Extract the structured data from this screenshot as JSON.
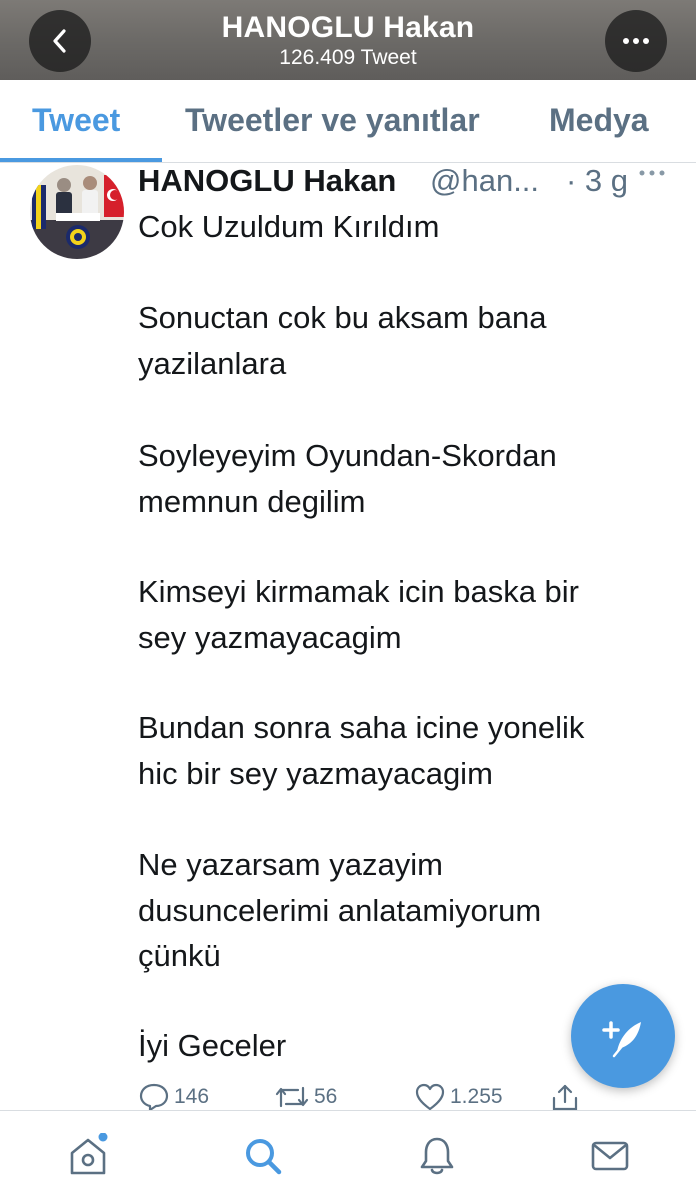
{
  "header": {
    "title": "HANOGLU Hakan",
    "subtitle": "126.409 Tweet"
  },
  "tabs": [
    {
      "label": "Tweet",
      "active": true
    },
    {
      "label": "Tweetler ve yanıtlar",
      "active": false
    },
    {
      "label": "Medya",
      "active": false
    }
  ],
  "tweet": {
    "author_name": "HANOGLU Hakan",
    "author_handle": "@han...",
    "time": "· 3 g",
    "lines": [
      "Cok Uzuldum Kırıldım",
      "Sonuctan cok bu aksam bana",
      "yazilanlara",
      "Soyleyeyim Oyundan-Skordan",
      "memnun degilim",
      "Kimseyi kirmamak icin baska bir",
      "sey yazmayacagim",
      "Bundan sonra saha icine yonelik",
      "hic bir sey yazmayacagim",
      "Ne yazarsam yazayim",
      "dusuncelerimi anlatamiyorum",
      "çünkü",
      "İyi Geceler"
    ],
    "replies": "146",
    "retweets": "56",
    "likes": "1.255"
  },
  "icons": {
    "back": "chevron-left-icon",
    "more": "ellipsis-icon",
    "compose": "compose-tweet-icon",
    "nav": [
      "home-icon",
      "search-icon",
      "bell-icon",
      "mail-icon"
    ]
  },
  "colors": {
    "accent": "#4a99e0",
    "muted": "#5b7083",
    "text": "#14171a"
  }
}
